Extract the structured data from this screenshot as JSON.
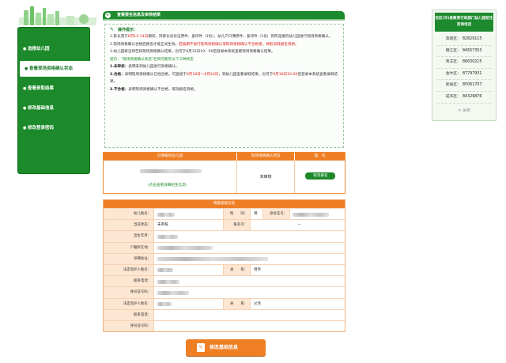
{
  "sidebar": {
    "items": [
      {
        "label": "选报幼儿园",
        "active": false
      },
      {
        "label": "查看现场资格确认状态",
        "active": true
      },
      {
        "label": "查看录取结果",
        "active": false
      },
      {
        "label": "修改基础信息",
        "active": false
      },
      {
        "label": "修改登录密码",
        "active": false
      }
    ]
  },
  "main": {
    "header_title": "查看报名信息及审核结果",
    "notice": {
      "title": "操作提示：",
      "p1_a": "1.家长须于",
      "p1_red": "6月13-14日",
      "p1_b": "期间，持家长身份证原件、复印件（1份），幼儿户口簿原件、复印件（1份）到所选报的幼儿园进行现场资格确认。",
      "p2_a": "2.现场资格确认合格后报名才能正式生效。",
      "p2_red": "若逾期不进行现场资格确认或现场资格确认不合格者，将取消其报名资格。",
      "p3": "3.幼儿园将当场告知现场资格确认结果。也可于6月15日10：00后登录本系统查看现场资格确认结果。",
      "hint": "提示：“现场资格确认状态”栏目可能有以下三种状态",
      "s1_b": "1.未审核：",
      "s1": "表明未到幼儿园进行资格确认。",
      "s2_b": "2.合格：",
      "s2_a": "表明现场资格确认已经合格，可直接于",
      "s2_red1": "6月18日～6月24日",
      "s2_mid": "，到幼儿园查看录取结果，也可于",
      "s2_red2": "6月18日10:00",
      "s2_c": "后登录本系统查看录取结果。",
      "s3_b": "3.不合格：",
      "s3": "表明现场资格确认不合格，取消报名资格。"
    }
  },
  "summary": {
    "headers": [
      "已填报的幼儿园",
      "现场资格确认状态",
      "操　作"
    ],
    "detail_link": "(点击查看详细招生信息)",
    "status": "未审核",
    "cancel_button": "取消报名"
  },
  "info": {
    "title": "填报基础信息",
    "labels": {
      "child_name": "幼儿姓名：",
      "gender": "性　　别：",
      "id_no": "身份证号：",
      "status": "当前状态：",
      "reg_no": "报名号：",
      "birth": "出生年月：",
      "hukou": "户籍所在地：",
      "address": "详细住址：",
      "guardian1": "法定监护人姓名：",
      "relation": "关　　系：",
      "phone": "联系电话：",
      "guardian_id": "身份证号码：",
      "guardian2": "法定监护人姓名："
    },
    "values": {
      "gender": "男",
      "status": "未审核",
      "reg_no": "—",
      "relation1": "母亲",
      "relation2": "父亲"
    }
  },
  "modify_button": "修改基础信息",
  "hotline": {
    "title": "告区(市)县教育行政部门幼儿园招生咨询电话",
    "rows": [
      {
        "district": "高新区：",
        "phone": "82829115"
      },
      {
        "district": "锦江区：",
        "phone": "84557353"
      },
      {
        "district": "青羊区：",
        "phone": "86630215"
      },
      {
        "district": "金牛区：",
        "phone": "87797931"
      },
      {
        "district": "武侯区：",
        "phone": "85061707"
      },
      {
        "district": "成华区：",
        "phone": "84329876"
      }
    ],
    "close": "关闭",
    "close_icon": "x-icon"
  },
  "colors": {
    "green": "#1c8a2a",
    "orange": "#ee7f25",
    "red": "#e0201c"
  }
}
